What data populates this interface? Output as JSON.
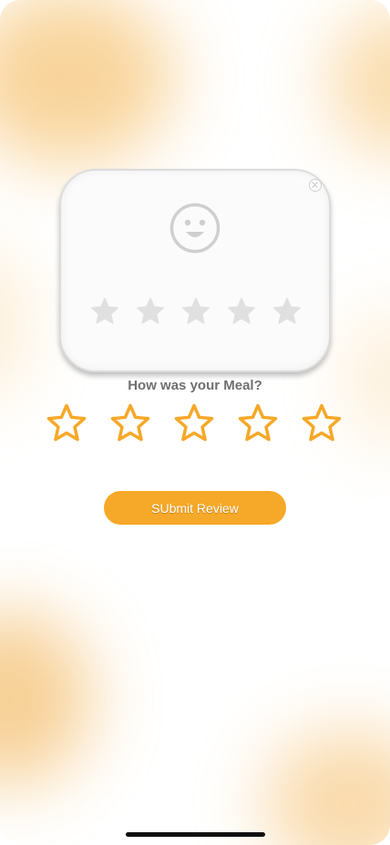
{
  "rating_card": {
    "face_icon": "smiley-face-icon",
    "star_icon": "star-filled-icon",
    "star_count": 5,
    "star_color": "#e0e0e0",
    "close_icon": "close-circle-icon"
  },
  "question": "How was your Meal?",
  "rating": {
    "star_icon": "star-outline-icon",
    "max": 5,
    "selected": 0,
    "star_color": "#f6a828"
  },
  "submit_button": {
    "label": "SUbmit Review",
    "color": "#f6a828"
  },
  "colors": {
    "accent": "#f6a828",
    "question_text": "#6f6f6f",
    "background_glow": "#f3b24a"
  }
}
